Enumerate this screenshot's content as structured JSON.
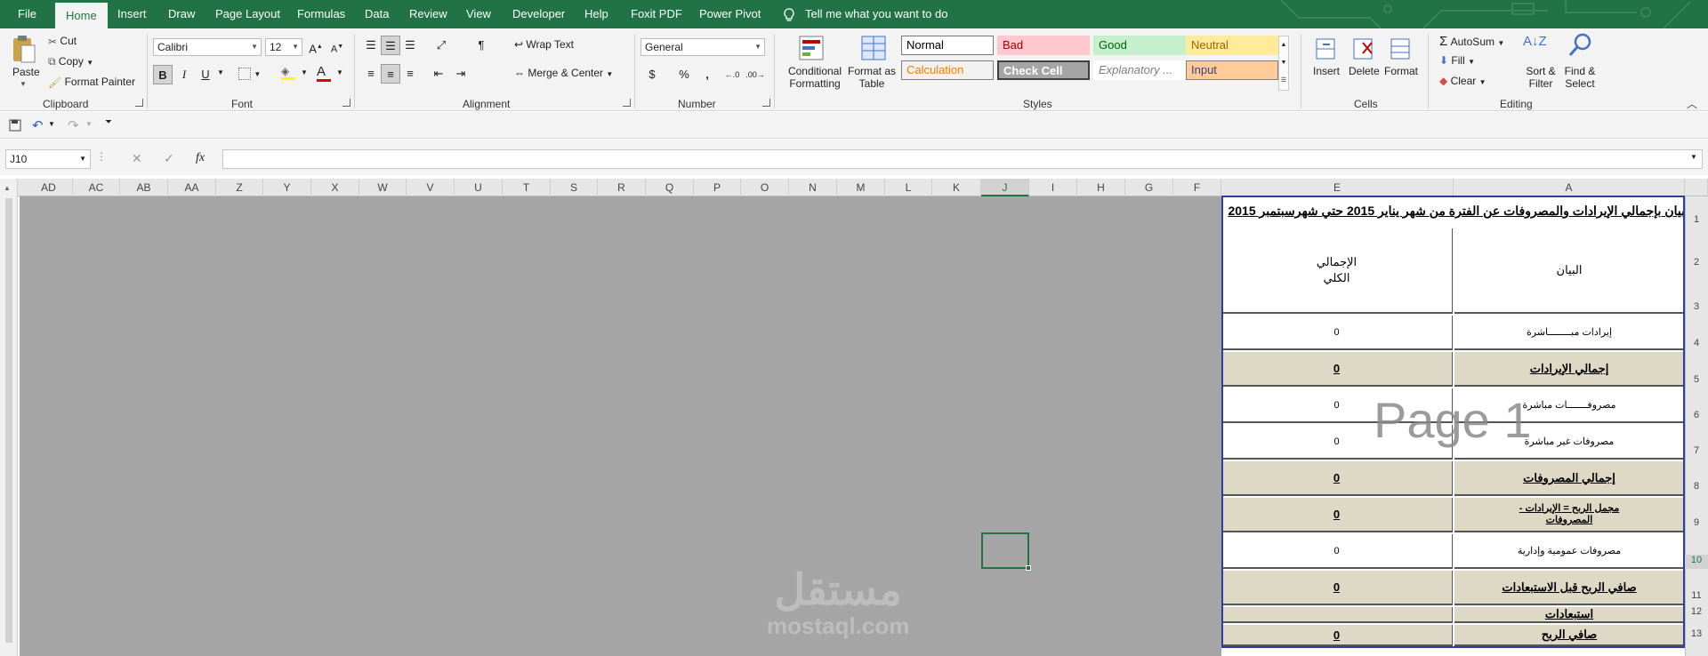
{
  "tabs": [
    "File",
    "Home",
    "Insert",
    "Draw",
    "Page Layout",
    "Formulas",
    "Data",
    "Review",
    "View",
    "Developer",
    "Help",
    "Foxit PDF",
    "Power Pivot"
  ],
  "tell_me": "Tell me what you want to do",
  "ribbon": {
    "clipboard": {
      "label": "Clipboard",
      "paste": "Paste",
      "cut": "Cut",
      "copy": "Copy",
      "format_painter": "Format Painter"
    },
    "font": {
      "label": "Font",
      "name": "Calibri",
      "size": "12",
      "bold": "B",
      "italic": "I",
      "underline": "U",
      "font_color_glyph": "A"
    },
    "alignment": {
      "label": "Alignment",
      "wrap": "Wrap Text",
      "merge": "Merge & Center"
    },
    "number": {
      "label": "Number",
      "format": "General",
      "currency": "$",
      "percent": "%",
      "comma": ","
    },
    "styles": {
      "label": "Styles",
      "conditional": "Conditional Formatting",
      "format_table": "Format as Table",
      "cells": [
        {
          "name": "Normal",
          "bg": "#ffffff",
          "fg": "#000000"
        },
        {
          "name": "Bad",
          "bg": "#ffc7ce",
          "fg": "#9c0006"
        },
        {
          "name": "Good",
          "bg": "#c6efce",
          "fg": "#006100"
        },
        {
          "name": "Neutral",
          "bg": "#ffeb9c",
          "fg": "#9c6500"
        },
        {
          "name": "Calculation",
          "bg": "#f2f2f2",
          "fg": "#fa7d00"
        },
        {
          "name": "Check Cell",
          "bg": "#a5a5a5",
          "fg": "#ffffff"
        },
        {
          "name": "Explanatory ...",
          "bg": "#ffffff",
          "fg": "#7f7f7f"
        },
        {
          "name": "Input",
          "bg": "#ffcc99",
          "fg": "#3f3f76"
        }
      ]
    },
    "cells_group": {
      "label": "Cells",
      "insert": "Insert",
      "delete": "Delete",
      "format": "Format"
    },
    "editing": {
      "label": "Editing",
      "autosum": "AutoSum",
      "fill": "Fill",
      "clear": "Clear",
      "sort_filter": "Sort & Filter",
      "find_select": "Find & Select"
    }
  },
  "namebox": "J10",
  "fx": "fx",
  "columns": [
    "AD",
    "AC",
    "AB",
    "AA",
    "Z",
    "Y",
    "X",
    "W",
    "V",
    "U",
    "T",
    "S",
    "R",
    "Q",
    "P",
    "O",
    "N",
    "M",
    "L",
    "K",
    "J",
    "I",
    "H",
    "G",
    "F",
    "E",
    "A"
  ],
  "selected_column": "J",
  "rows": [
    "1",
    "2",
    "3",
    "4",
    "5",
    "6",
    "7",
    "8",
    "9",
    "10",
    "11",
    "12",
    "13"
  ],
  "selected_row": "10",
  "sheet": {
    "title": "بيان بإجمالي الإيرادات والمصروفات عن الفترة من شهر يناير 2015 حتي شهرسبتمبر 2015",
    "header_a": "البيان",
    "header_e": "الإجمالي الكلي",
    "rows": [
      {
        "label": "إيرادات مبــــــــاشرة",
        "value": "0",
        "shaded": false
      },
      {
        "label": "إجمالي الإيرادات",
        "value": "0",
        "shaded": true
      },
      {
        "label": "مصروفـــــــات مباشرة",
        "value": "0",
        "shaded": false
      },
      {
        "label": "مصروفات غير مباشرة",
        "value": "0",
        "shaded": false
      },
      {
        "label": "إجمالي المصروفات",
        "value": "0",
        "shaded": true
      },
      {
        "label": "مجمل الربح = الإيرادات - المصروفات",
        "value": "0",
        "shaded": true
      },
      {
        "label": "مصروفات عمومية وإدارية",
        "value": "0",
        "shaded": false
      },
      {
        "label": "صافي الربح قبل الاستبعادات",
        "value": "0",
        "shaded": true
      },
      {
        "label": "استبعادات",
        "value": "",
        "shaded": true
      },
      {
        "label": "صافي الربح",
        "value": "0",
        "shaded": true
      }
    ]
  },
  "page_watermark": "Page 1",
  "site_watermark": {
    "arabic": "مستقل",
    "latin": "mostaql.com"
  }
}
